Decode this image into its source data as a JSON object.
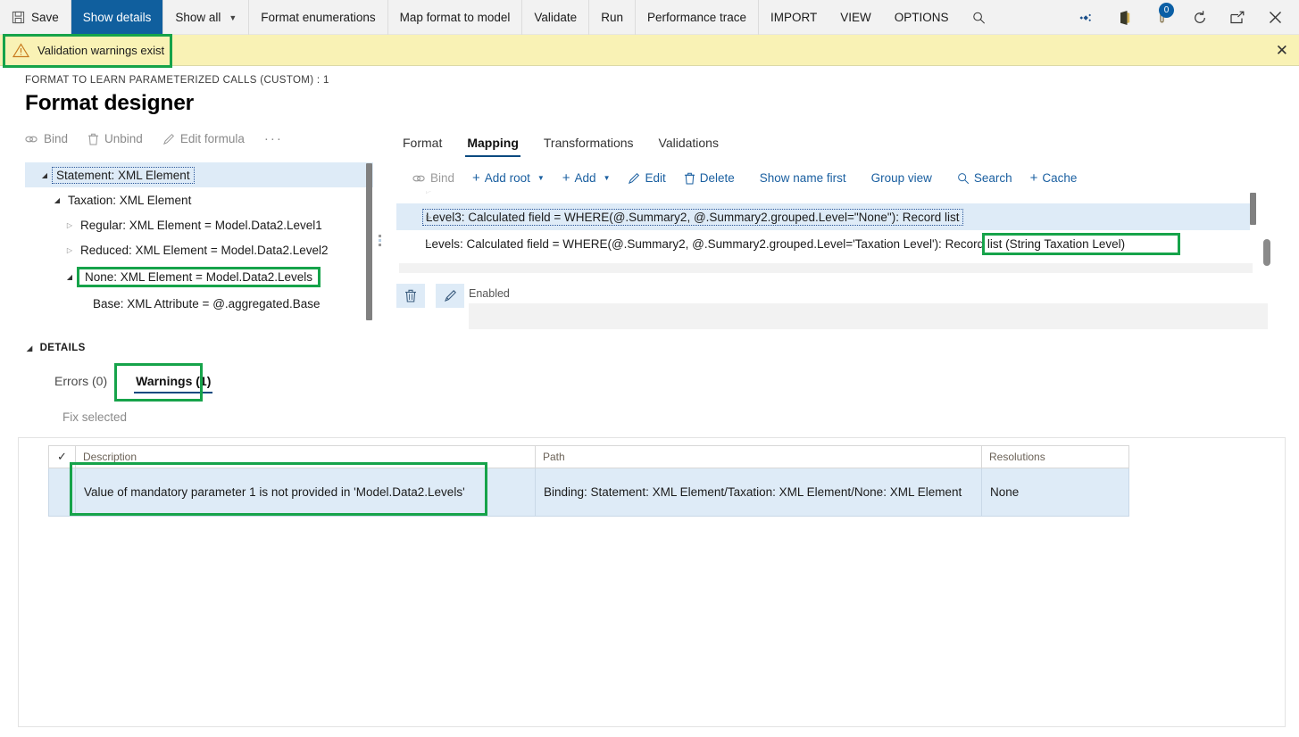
{
  "commandbar": {
    "items": [
      {
        "label": "Save",
        "icon": "save-icon",
        "state": "normal"
      },
      {
        "label": "Show details",
        "icon": "none",
        "state": "active"
      },
      {
        "label": "Show all",
        "icon": "none",
        "state": "dropdown"
      },
      {
        "label": "Format enumerations",
        "icon": "none",
        "state": "normal"
      },
      {
        "label": "Map format to model",
        "icon": "none",
        "state": "normal"
      },
      {
        "label": "Validate",
        "icon": "none",
        "state": "normal"
      },
      {
        "label": "Run",
        "icon": "none",
        "state": "normal"
      },
      {
        "label": "Performance trace",
        "icon": "none",
        "state": "normal"
      },
      {
        "label": "IMPORT",
        "icon": "none",
        "state": "normal"
      },
      {
        "label": "VIEW",
        "icon": "none",
        "state": "normal"
      },
      {
        "label": "OPTIONS",
        "icon": "none",
        "state": "normal"
      }
    ],
    "search_icon": "search-icon",
    "right_icons": [
      {
        "name": "dynamics-diamond-icon"
      },
      {
        "name": "office-app-launcher-icon"
      },
      {
        "name": "notifications-icon",
        "badge": "0"
      },
      {
        "name": "refresh-icon"
      },
      {
        "name": "popout-icon"
      },
      {
        "name": "close-icon"
      }
    ],
    "notification_count": "0",
    "accent_color": "#105f9e"
  },
  "warning_banner": {
    "icon": "warning-triangle-icon",
    "text": "Validation warnings exist",
    "close_label": "✕",
    "background": "#f9f2b5"
  },
  "header": {
    "breadcrumb": "FORMAT TO LEARN PARAMETERIZED CALLS (CUSTOM) : 1",
    "title": "Format designer"
  },
  "left_panel": {
    "toolbar": [
      {
        "label": "Bind",
        "icon": "link-icon"
      },
      {
        "label": "Unbind",
        "icon": "trash-icon"
      },
      {
        "label": "Edit formula",
        "icon": "pencil-icon"
      },
      {
        "label": "···",
        "icon": "more-icon"
      }
    ],
    "tree": [
      {
        "label": "Statement: XML Element",
        "indent": 0,
        "arrow": "open",
        "selected": true,
        "focused": true,
        "annotated": false
      },
      {
        "label": "Taxation: XML Element",
        "indent": 1,
        "arrow": "open",
        "selected": false,
        "focused": false,
        "annotated": false
      },
      {
        "label": "Regular: XML Element = Model.Data2.Level1",
        "indent": 2,
        "arrow": "closed",
        "selected": false,
        "focused": false,
        "annotated": false
      },
      {
        "label": "Reduced: XML Element = Model.Data2.Level2",
        "indent": 2,
        "arrow": "closed",
        "selected": false,
        "focused": false,
        "annotated": false
      },
      {
        "label": "None: XML Element = Model.Data2.Levels",
        "indent": 2,
        "arrow": "open",
        "selected": false,
        "focused": false,
        "annotated": true
      },
      {
        "label": "Base: XML Attribute = @.aggregated.Base",
        "indent": 3,
        "arrow": "none",
        "selected": false,
        "focused": false,
        "annotated": false
      }
    ]
  },
  "details": {
    "section_label": "DETAILS",
    "tabs": [
      {
        "label": "Errors (0)",
        "selected": false
      },
      {
        "label": "Warnings (1)",
        "selected": true
      }
    ],
    "fix_selected_label": "Fix selected",
    "grid": {
      "columns": [
        "✓",
        "Description",
        "Path",
        "Resolutions"
      ],
      "rows": [
        {
          "check": "",
          "description": "Value of mandatory parameter 1 is not provided in 'Model.Data2.Levels'",
          "path": "Binding: Statement: XML Element/Taxation: XML Element/None: XML Element",
          "resolutions": "None"
        }
      ]
    }
  },
  "right_panel": {
    "tabs": [
      {
        "label": "Format",
        "selected": false
      },
      {
        "label": "Mapping",
        "selected": true
      },
      {
        "label": "Transformations",
        "selected": false
      },
      {
        "label": "Validations",
        "selected": false
      }
    ],
    "toolbar": [
      {
        "label": "Bind",
        "icon": "link-icon",
        "disabled": true,
        "dropdown": false
      },
      {
        "label": "Add root",
        "icon": "plus-icon",
        "disabled": false,
        "dropdown": true
      },
      {
        "label": "Add",
        "icon": "plus-icon",
        "disabled": false,
        "dropdown": true
      },
      {
        "label": "Edit",
        "icon": "pencil-icon",
        "disabled": false,
        "dropdown": false
      },
      {
        "label": "Delete",
        "icon": "trash-icon",
        "disabled": false,
        "dropdown": false
      },
      {
        "label": "Show name first",
        "icon": "none",
        "disabled": false,
        "dropdown": false
      },
      {
        "label": "Group view",
        "icon": "none",
        "disabled": false,
        "dropdown": false
      },
      {
        "label": "Search",
        "icon": "search-icon",
        "disabled": false,
        "dropdown": false
      },
      {
        "label": "Cache",
        "icon": "plus-icon",
        "disabled": false,
        "dropdown": false
      }
    ],
    "mapping_rows": [
      {
        "label": "Level3: Calculated field = WHERE(@.Summary2, @.Summary2.grouped.Level=\"None\"): Record list",
        "selected": true,
        "focused": true,
        "arrow": "closed"
      },
      {
        "label": "Levels: Calculated field = WHERE(@.Summary2, @.Summary2.grouped.Level='Taxation Level'): Record list (String Taxation Level)",
        "selected": false,
        "focused": false,
        "arrow": "closed"
      }
    ],
    "properties": {
      "delete_icon": "trash-icon",
      "edit_icon": "pencil-icon",
      "field_label": "Enabled",
      "field_value": ""
    }
  },
  "annotations": {
    "color": "#16a34a",
    "boxes": [
      "validation-warnings-banner",
      "none-xml-element-tree-node",
      "record-list-string-taxation-level",
      "warnings-tab",
      "warning-description-cell"
    ]
  }
}
